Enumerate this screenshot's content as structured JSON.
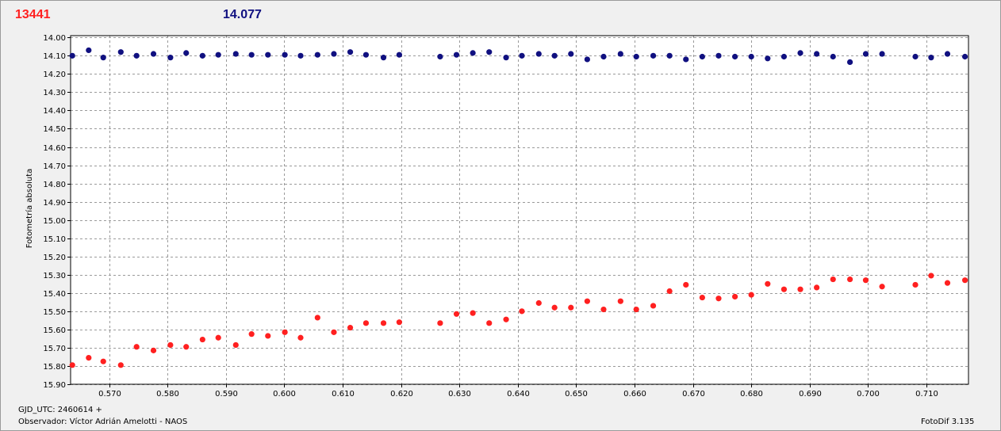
{
  "header": {
    "value_red": "13441",
    "value_blue": "14.077",
    "color_red": "#ff2020",
    "color_blue": "#101080"
  },
  "footer": {
    "jd_label": "GJD_UTC: 2460614 +",
    "observer": "Observador: Víctor Adrián Amelotti - NAOS",
    "version": "FotoDif 3.135"
  },
  "chart_data": {
    "type": "scatter",
    "title": "",
    "xlabel": "",
    "ylabel": "Fotometría absoluta",
    "xlim": [
      0.5634,
      0.7172
    ],
    "ylim": [
      13.99,
      15.9
    ],
    "y_inverted": true,
    "grid": true,
    "x_ticks": [
      "0.570",
      "0.580",
      "0.590",
      "0.600",
      "0.610",
      "0.620",
      "0.630",
      "0.640",
      "0.650",
      "0.660",
      "0.670",
      "0.680",
      "0.690",
      "0.700",
      "0.710"
    ],
    "y_ticks": [
      "14.00",
      "14.10",
      "14.20",
      "14.30",
      "14.40",
      "14.50",
      "14.60",
      "14.70",
      "14.80",
      "14.90",
      "15.00",
      "15.10",
      "15.20",
      "15.30",
      "15.40",
      "15.50",
      "15.60",
      "15.70",
      "15.80",
      "15.90"
    ],
    "series": [
      {
        "color": "#101080",
        "x": [
          0.5637,
          0.5665,
          0.569,
          0.572,
          0.5747,
          0.5776,
          0.5805,
          0.5832,
          0.586,
          0.5887,
          0.5917,
          0.5944,
          0.5972,
          0.6001,
          0.6028,
          0.6057,
          0.6085,
          0.6113,
          0.614,
          0.617,
          0.6197,
          0.6267,
          0.6295,
          0.6323,
          0.6351,
          0.638,
          0.6407,
          0.6436,
          0.6463,
          0.6491,
          0.6519,
          0.6547,
          0.6576,
          0.6603,
          0.6632,
          0.666,
          0.6688,
          0.6716,
          0.6744,
          0.6772,
          0.68,
          0.6828,
          0.6856,
          0.6884,
          0.6912,
          0.694,
          0.6969,
          0.6996,
          0.7024,
          0.7081,
          0.7108,
          0.7136,
          0.7166
        ],
        "y": [
          14.1,
          14.07,
          14.11,
          14.08,
          14.1,
          14.09,
          14.11,
          14.085,
          14.1,
          14.095,
          14.09,
          14.095,
          14.095,
          14.095,
          14.1,
          14.095,
          14.09,
          14.08,
          14.095,
          14.11,
          14.095,
          14.105,
          14.095,
          14.085,
          14.08,
          14.11,
          14.1,
          14.09,
          14.1,
          14.09,
          14.12,
          14.105,
          14.09,
          14.105,
          14.1,
          14.1,
          14.12,
          14.105,
          14.1,
          14.105,
          14.105,
          14.115,
          14.105,
          14.085,
          14.09,
          14.105,
          14.135,
          14.09,
          14.09,
          14.105,
          14.11,
          14.09,
          14.105
        ]
      },
      {
        "color": "#ff2020",
        "x": [
          0.5637,
          0.5665,
          0.569,
          0.572,
          0.5747,
          0.5776,
          0.5805,
          0.5832,
          0.586,
          0.5887,
          0.5917,
          0.5944,
          0.5972,
          0.6001,
          0.6028,
          0.6057,
          0.6085,
          0.6113,
          0.614,
          0.617,
          0.6197,
          0.6267,
          0.6295,
          0.6323,
          0.6351,
          0.638,
          0.6407,
          0.6436,
          0.6463,
          0.6491,
          0.6519,
          0.6547,
          0.6576,
          0.6603,
          0.6632,
          0.666,
          0.6688,
          0.6716,
          0.6744,
          0.6772,
          0.68,
          0.6828,
          0.6856,
          0.6884,
          0.6912,
          0.694,
          0.6969,
          0.6996,
          0.7024,
          0.7081,
          0.7108,
          0.7136,
          0.7166
        ],
        "y": [
          15.795,
          15.755,
          15.775,
          15.795,
          15.695,
          15.715,
          15.685,
          15.695,
          15.655,
          15.645,
          15.685,
          15.625,
          15.635,
          15.615,
          15.645,
          15.535,
          15.615,
          15.59,
          15.565,
          15.565,
          15.56,
          15.565,
          15.515,
          15.51,
          15.565,
          15.545,
          15.5,
          15.455,
          15.48,
          15.48,
          15.445,
          15.49,
          15.445,
          15.49,
          15.47,
          15.39,
          15.355,
          15.425,
          15.43,
          15.42,
          15.41,
          15.35,
          15.38,
          15.38,
          15.37,
          15.325,
          15.325,
          15.33,
          15.365,
          15.355,
          15.305,
          15.345,
          15.33
        ]
      }
    ]
  }
}
